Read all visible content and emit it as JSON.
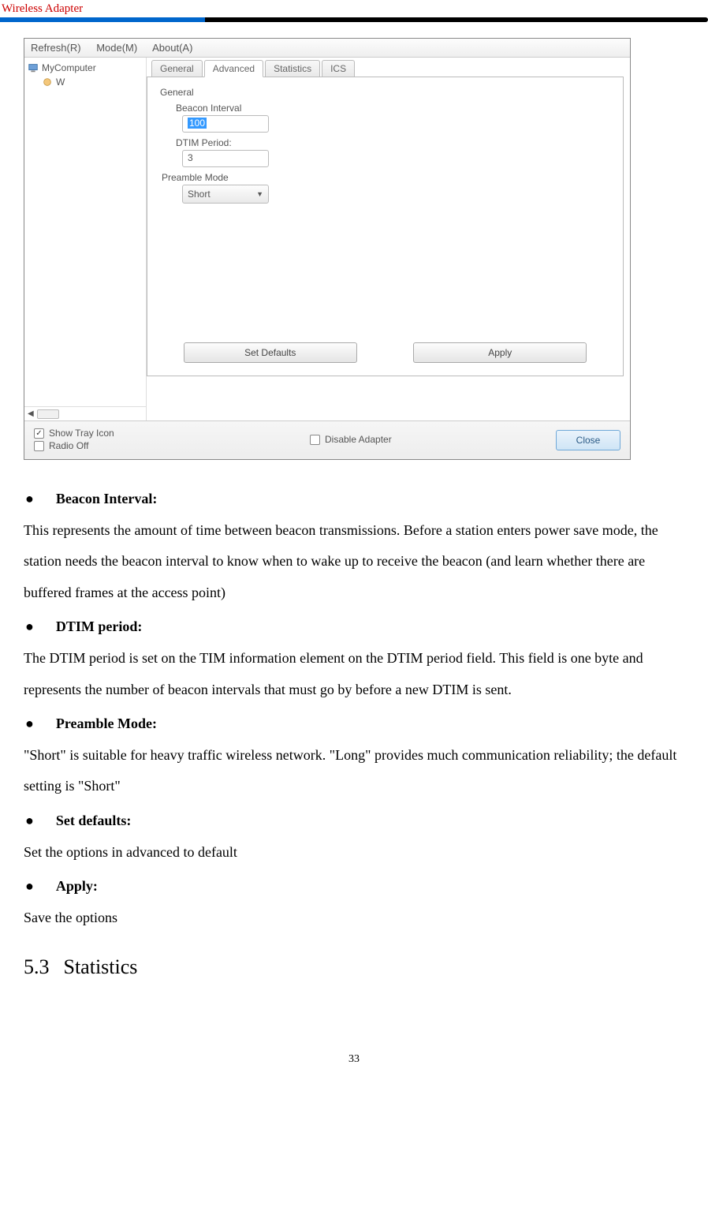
{
  "header": {
    "title": "Wireless  Adapter"
  },
  "window": {
    "menu": {
      "refresh": "Refresh(R)",
      "mode": "Mode(M)",
      "about": "About(A)"
    },
    "tree": {
      "root": "MyComputer",
      "sub": "W"
    },
    "tabs": {
      "general": "General",
      "advanced": "Advanced",
      "statistics": "Statistics",
      "ics": "ICS"
    },
    "panel": {
      "section": "General",
      "beacon_label": "Beacon Interval",
      "beacon_value": "100",
      "dtim_label": "DTIM Period:",
      "dtim_value": "3",
      "preamble_label": "Preamble Mode",
      "preamble_value": "Short",
      "set_defaults": "Set Defaults",
      "apply": "Apply"
    },
    "bottom": {
      "show_tray": "Show Tray Icon",
      "radio_off": "Radio Off",
      "disable_adapter": "Disable Adapter",
      "close": "Close"
    }
  },
  "doc": {
    "beacon_h": "Beacon Interval:",
    "beacon_p": "This represents the amount of time between beacon transmissions. Before a station enters power save mode, the station needs the beacon interval to know when to wake up to receive the beacon (and learn whether there are buffered frames at the access point)",
    "dtim_h": "DTIM period:",
    "dtim_p": "The DTIM period is set on the TIM information element on the DTIM period field. This field is one byte and represents the number of beacon intervals that must go by before a new DTIM is sent.",
    "preamble_h": "Preamble Mode:",
    "preamble_p": "\"Short\" is suitable for heavy traffic wireless network. \"Long\" provides much communication reliability; the default setting is \"Short\"",
    "setdef_h": "Set defaults:",
    "setdef_p": "Set the options in advanced to default",
    "apply_h": "Apply:",
    "apply_p": "Save the options",
    "section_num": "5.3",
    "section_title": "Statistics"
  },
  "page_number": "33"
}
